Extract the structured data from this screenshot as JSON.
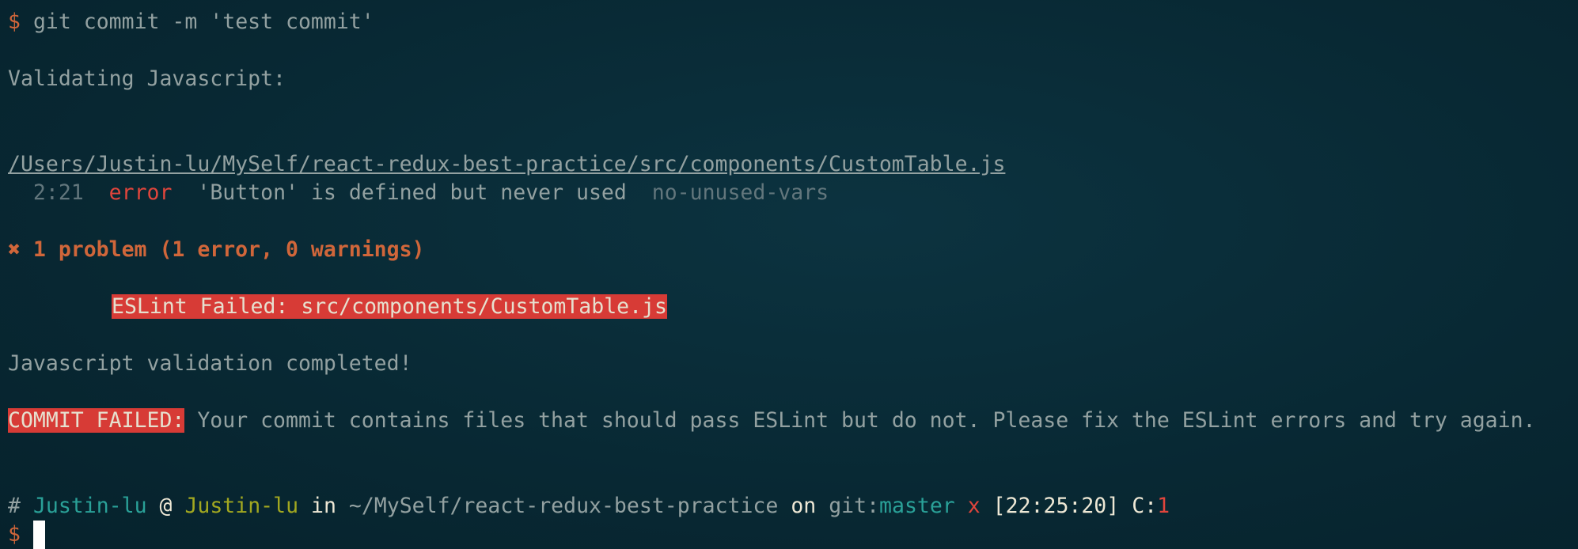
{
  "terminal": {
    "command_prompt": "$",
    "command": "git commit -m 'test commit'",
    "validating": "Validating Javascript:",
    "file_path": "/Users/Justin-lu/MySelf/react-redux-best-practice/src/components/CustomTable.js",
    "lint_error": {
      "location": "2:21",
      "severity": "error",
      "message": "'Button' is defined but never used",
      "rule": "no-unused-vars"
    },
    "problem_summary": "✖ 1 problem (1 error, 0 warnings)",
    "eslint_failed": "ESLint Failed: src/components/CustomTable.js",
    "validation_completed": "Javascript validation completed!",
    "commit_failed_label": "COMMIT FAILED:",
    "commit_failed_message": " Your commit contains files that should pass ESLint but do not. Please fix the ESLint errors and try again.",
    "prompt": {
      "hash": "#",
      "user": "Justin-lu",
      "at": "@",
      "host": "Justin-lu",
      "in": "in",
      "dir": "~/MySelf/react-redux-best-practice",
      "on": "on",
      "git_prefix": "git:",
      "branch": "master",
      "dirty_mark": "x",
      "time": "[22:25:20]",
      "code_label": "C:",
      "code": "1",
      "symbol": "$"
    }
  },
  "colors": {
    "background": "#082833",
    "text": "#93a1a1",
    "error": "#dc322f",
    "prompt_symbol": "#cb4b16",
    "user": "#2aa198",
    "host": "#859900"
  }
}
